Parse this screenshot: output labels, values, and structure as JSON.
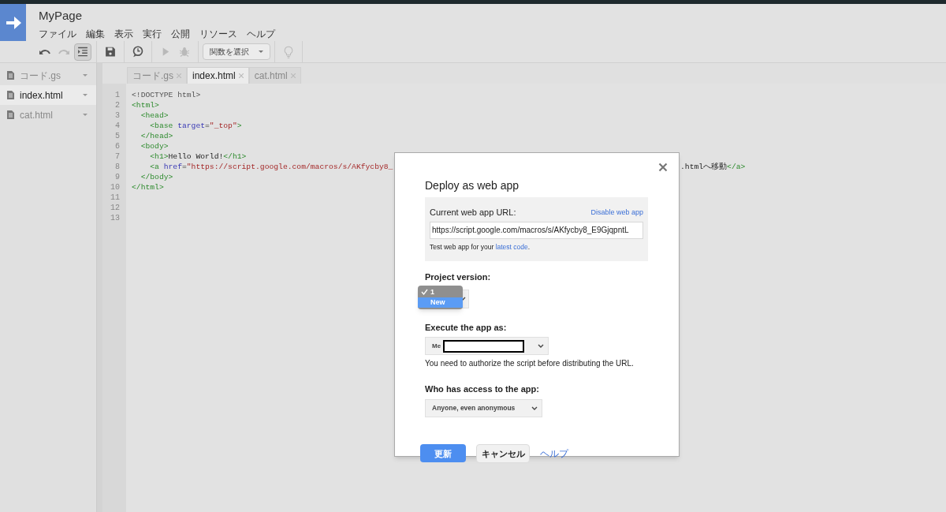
{
  "header": {
    "title": "MyPage",
    "menus": [
      "ファイル",
      "編集",
      "表示",
      "実行",
      "公開",
      "リソース",
      "ヘルプ"
    ]
  },
  "toolbar": [
    {
      "kind": "undo",
      "disabled": false
    },
    {
      "kind": "redo",
      "disabled": true
    },
    {
      "kind": "indent",
      "disabled": false,
      "on": true
    },
    {
      "kind": "save",
      "disabled": false
    },
    {
      "kind": "clock",
      "disabled": false
    },
    {
      "kind": "run",
      "disabled": true
    },
    {
      "kind": "debug",
      "disabled": true
    },
    {
      "kind": "select",
      "label": "関数を選択"
    },
    {
      "kind": "bulb",
      "disabled": true
    }
  ],
  "sidebar": {
    "files": [
      {
        "name": "コード.gs",
        "selected": false
      },
      {
        "name": "index.html",
        "selected": true
      },
      {
        "name": "cat.html",
        "selected": false
      }
    ]
  },
  "editor": {
    "tabs": [
      {
        "label": "コード.gs",
        "selected": false
      },
      {
        "label": "index.html",
        "selected": true
      },
      {
        "label": "cat.html",
        "selected": false
      }
    ],
    "lines": [
      {
        "number": "1",
        "tokens": [
          {
            "kind": "doctype",
            "text": "<!DOCTYPE html>"
          }
        ]
      },
      {
        "number": "2",
        "tokens": [
          {
            "kind": "tag",
            "text": "<html>"
          }
        ]
      },
      {
        "number": "3",
        "tokens": [
          {
            "kind": "tag",
            "text": "  <head>"
          }
        ]
      },
      {
        "number": "4",
        "tokens": [
          {
            "kind": "tag",
            "text": "    <base "
          },
          {
            "kind": "attr",
            "text": "target"
          },
          {
            "kind": "plain",
            "text": "="
          },
          {
            "kind": "string",
            "text": "\"_top\""
          },
          {
            "kind": "tag",
            "text": ">"
          }
        ]
      },
      {
        "number": "5",
        "tokens": [
          {
            "kind": "tag",
            "text": "  </head>"
          }
        ]
      },
      {
        "number": "6",
        "tokens": [
          {
            "kind": "tag",
            "text": "  <body>"
          }
        ]
      },
      {
        "number": "7",
        "tokens": [
          {
            "kind": "tag",
            "text": "    <h1>"
          },
          {
            "kind": "plain",
            "text": "Hello World!"
          },
          {
            "kind": "tag",
            "text": "</h1>"
          }
        ]
      },
      {
        "number": "8",
        "tokens": [
          {
            "kind": "tag",
            "text": "    <a "
          },
          {
            "kind": "attr",
            "text": "href"
          },
          {
            "kind": "plain",
            "text": "="
          },
          {
            "kind": "string",
            "text": "\"https://script.google.com/macros/s/AKfycby8_"
          }
        ],
        "after_dialog": [
          {
            "kind": "plain",
            "text": ".htmlへ移動"
          },
          {
            "kind": "tag",
            "text": "</a>"
          }
        ]
      },
      {
        "number": "9",
        "tokens": [
          {
            "kind": "tag",
            "text": "  </body>"
          }
        ]
      },
      {
        "number": "10",
        "tokens": [
          {
            "kind": "tag",
            "text": "</html>"
          }
        ]
      },
      {
        "number": "11"
      },
      {
        "number": "12"
      },
      {
        "number": "13"
      }
    ]
  },
  "dialog": {
    "title": "Deploy as web app",
    "url_label": "Current web app URL:",
    "disable_link": "Disable web app",
    "url_value": "https://script.google.com/macros/s/AKfycby8_E9GjqpntL",
    "test_text": "Test web app for your **latest code**.",
    "version_label": "Project version:",
    "version_options": [
      {
        "label": "1",
        "checked": true,
        "selected": false
      },
      {
        "label": "New",
        "checked": false,
        "selected": true
      }
    ],
    "execute_label": "Execute the app as:",
    "execute_value": "Me",
    "auth_note": "You need to authorize the script before distributing the URL.",
    "access_label": "Who has access to the app:",
    "access_value": "Anyone, even anonymous",
    "buttons": {
      "update": "更新",
      "cancel": "キャンセル",
      "help": "ヘルプ"
    }
  }
}
